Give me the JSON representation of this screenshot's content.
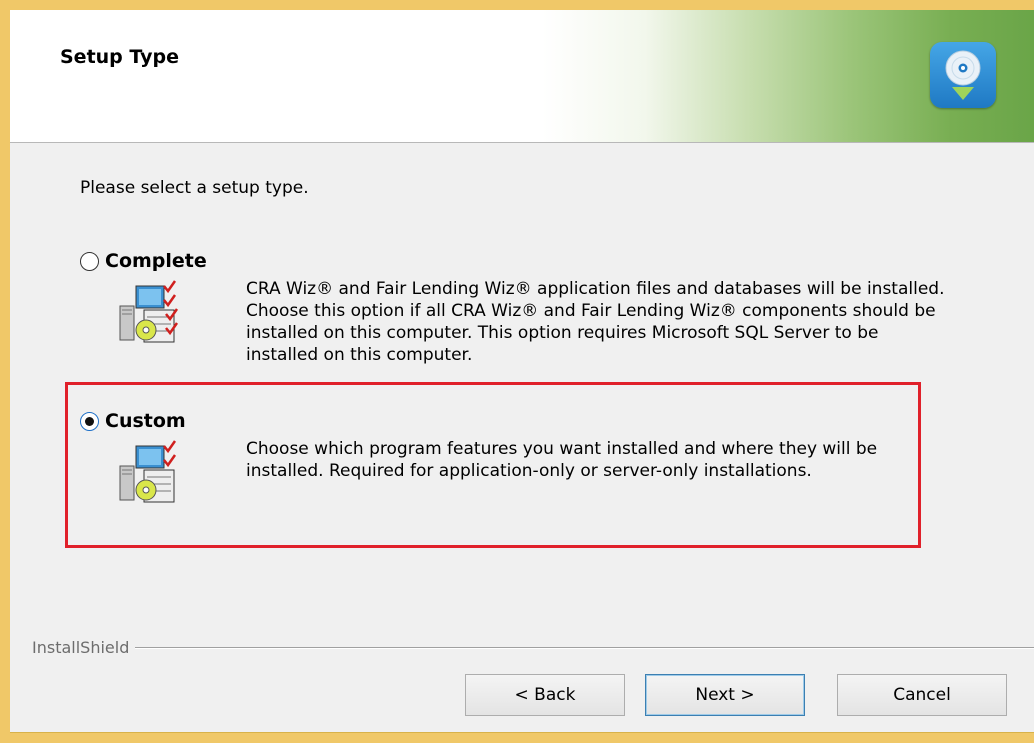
{
  "header": {
    "title": "Setup Type",
    "logo_icon": "cd-install-icon"
  },
  "intro_text": "Please select a setup type.",
  "options": [
    {
      "label": "Complete",
      "selected": false,
      "icon": "setup-components-icon",
      "description": "CRA Wiz® and Fair Lending Wiz® application files and databases will be installed. Choose this option if all CRA Wiz® and Fair Lending Wiz® components should be installed on this computer. This option requires Microsoft SQL Server to be installed on this computer."
    },
    {
      "label": "Custom",
      "selected": true,
      "icon": "setup-components-icon",
      "description": "Choose which program features you want installed and where they will be installed. Required for application-only or server-only installations."
    }
  ],
  "brand": "InstallShield",
  "buttons": {
    "back": "< Back",
    "next": "Next >",
    "cancel": "Cancel"
  },
  "colors": {
    "highlight": "#e0202a",
    "header_gradient_end": "#6aa548",
    "logo_blue": "#1f79c4",
    "background": "#f0f0f0"
  }
}
